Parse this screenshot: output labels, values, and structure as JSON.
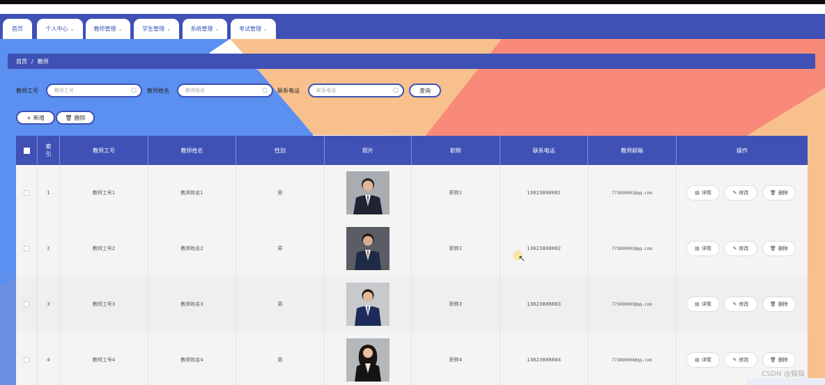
{
  "nav": {
    "tabs": [
      {
        "label": "首页",
        "has_dropdown": false
      },
      {
        "label": "个人中心",
        "has_dropdown": true
      },
      {
        "label": "教师管理",
        "has_dropdown": true
      },
      {
        "label": "学生管理",
        "has_dropdown": true
      },
      {
        "label": "系统管理",
        "has_dropdown": true
      },
      {
        "label": "考试管理",
        "has_dropdown": true
      }
    ]
  },
  "breadcrumb": {
    "home": "首页",
    "separator": "/",
    "current": "教师"
  },
  "search": {
    "teacher_id_label": "教师工号",
    "teacher_id_placeholder": "教师工号",
    "teacher_name_label": "教师姓名",
    "teacher_name_placeholder": "教师姓名",
    "phone_label": "联系电话",
    "phone_placeholder": "联系电话",
    "query_button": "查询"
  },
  "actions": {
    "add_button": "新增",
    "delete_button": "删除"
  },
  "table": {
    "headers": {
      "index": "索引",
      "teacher_id": "教师工号",
      "teacher_name": "教师姓名",
      "gender": "性别",
      "photo": "照片",
      "title": "职称",
      "phone": "联系电话",
      "email": "教师邮箱",
      "operation": "操作"
    },
    "row_buttons": {
      "detail": "详情",
      "edit": "修改",
      "delete": "删除"
    },
    "rows": [
      {
        "index": "1",
        "teacher_id": "教师工号1",
        "teacher_name": "教师姓名1",
        "gender": "男",
        "title": "职称1",
        "phone": "13823888881",
        "email": "773890001@qq.com"
      },
      {
        "index": "2",
        "teacher_id": "教师工号2",
        "teacher_name": "教师姓名2",
        "gender": "男",
        "title": "职称2",
        "phone": "13823888882",
        "email": "773890002@qq.com"
      },
      {
        "index": "3",
        "teacher_id": "教师工号3",
        "teacher_name": "教师姓名3",
        "gender": "男",
        "title": "职称3",
        "phone": "13823888883",
        "email": "773890003@qq.com"
      },
      {
        "index": "4",
        "teacher_id": "教师工号4",
        "teacher_name": "教师姓名4",
        "gender": "男",
        "title": "职称4",
        "phone": "13823888884",
        "email": "773890004@qq.com"
      }
    ]
  },
  "watermark": "CSDN @猫猫",
  "colors": {
    "primary": "#3f51b5",
    "bg_blue": "#5b8ff0",
    "bg_peach": "#f7c08d",
    "bg_coral": "#f98a7a"
  }
}
